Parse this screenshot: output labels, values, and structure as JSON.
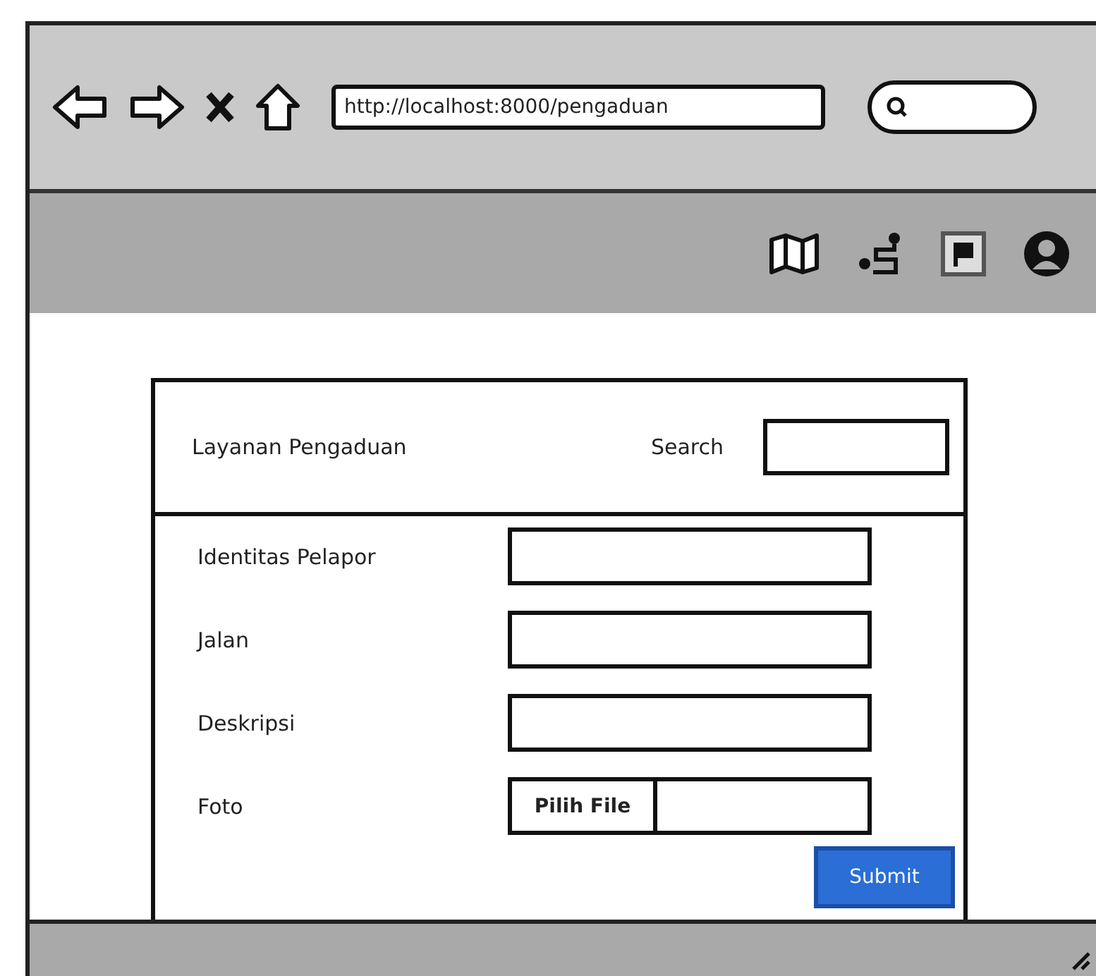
{
  "browser": {
    "url": "http://localhost:8000/pengaduan"
  },
  "form": {
    "title": "Layanan Pengaduan",
    "search_label": "Search",
    "fields": [
      {
        "label": "Identitas Pelapor",
        "kind": "text"
      },
      {
        "label": "Jalan",
        "kind": "text"
      },
      {
        "label": "Deskripsi",
        "kind": "text"
      },
      {
        "label": "Foto",
        "kind": "file",
        "button": "Pilih File"
      }
    ],
    "submit": "Submit"
  }
}
